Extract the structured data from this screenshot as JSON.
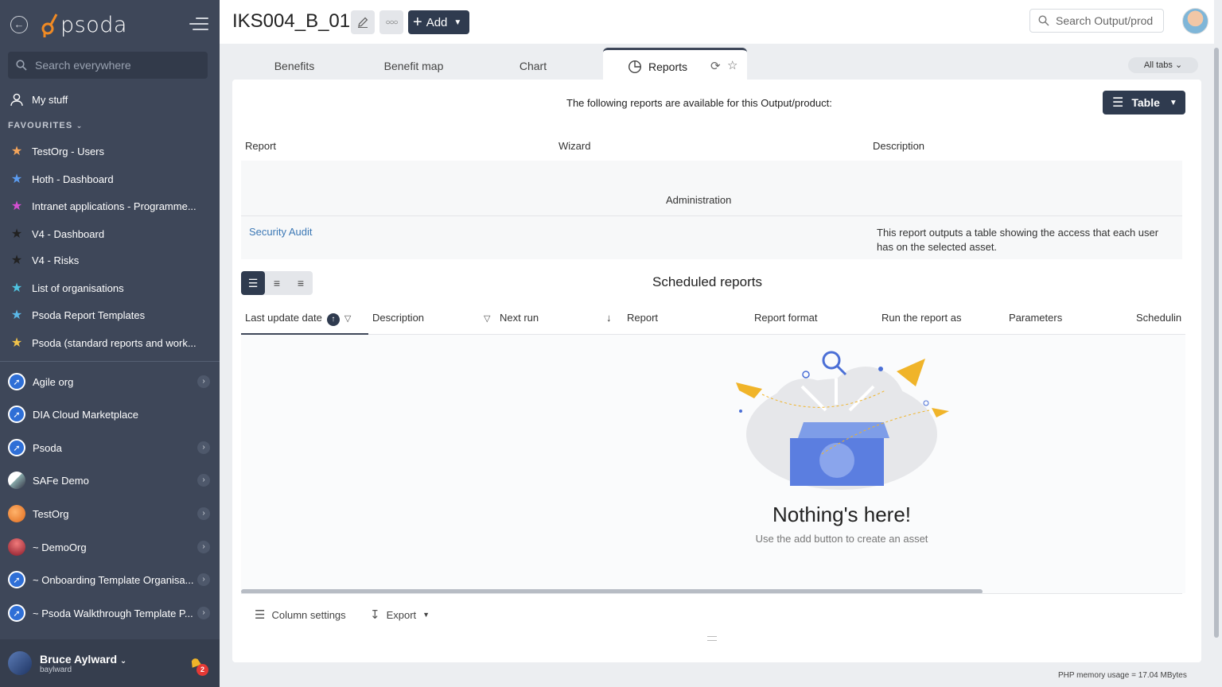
{
  "sidebar": {
    "logo_text": "psoda",
    "search_placeholder": "Search everywhere",
    "my_stuff": "My stuff",
    "favourites_header": "FAVOURITES",
    "favourites": [
      {
        "label": "TestOrg - Users",
        "star_color": "#f5a55a"
      },
      {
        "label": "Hoth - Dashboard",
        "star_color": "#5b9cf0"
      },
      {
        "label": "Intranet applications - Programme...",
        "star_color": "#d44fd1"
      },
      {
        "label": "V4 - Dashboard",
        "star_color": "#222222"
      },
      {
        "label": "V4 - Risks",
        "star_color": "#222222"
      },
      {
        "label": "List of organisations",
        "star_color": "#4ec3e0"
      },
      {
        "label": "Psoda Report Templates",
        "star_color": "#5bb8e8"
      },
      {
        "label": "Psoda (standard reports and work...",
        "star_color": "#f0c24a"
      }
    ],
    "orgs": [
      {
        "label": "Agile org",
        "chevron": true
      },
      {
        "label": "DIA Cloud Marketplace",
        "chevron": false
      },
      {
        "label": "Psoda",
        "chevron": true
      },
      {
        "label": "SAFe Demo",
        "chevron": true
      },
      {
        "label": "TestOrg",
        "chevron": true
      },
      {
        "label": "~ DemoOrg",
        "chevron": true
      },
      {
        "label": "~ Onboarding Template Organisa...",
        "chevron": true
      },
      {
        "label": "~ Psoda Walkthrough Template P...",
        "chevron": true
      }
    ],
    "user": {
      "name": "Bruce Aylward",
      "login": "baylward",
      "notifications": "2"
    }
  },
  "topbar": {
    "title": "IKS004_B_01",
    "add_label": "Add",
    "search_placeholder": "Search Output/prod"
  },
  "tabs": {
    "items": [
      "Benefits",
      "Benefit map",
      "Chart"
    ],
    "active": "Reports",
    "all_tabs": "All tabs"
  },
  "reports": {
    "intro": "The following reports are available for this Output/product:",
    "view_button": "Table",
    "columns": [
      "Report",
      "Wizard",
      "Description"
    ],
    "group": "Administration",
    "rows": [
      {
        "report": "Security Audit",
        "wizard": "",
        "description": "This report outputs a table showing the access that each user has on the selected asset."
      }
    ]
  },
  "scheduled": {
    "title": "Scheduled reports",
    "columns": [
      "Last update date",
      "Description",
      "Next run",
      "Report",
      "Report format",
      "Run the report as",
      "Parameters",
      "Schedulin"
    ],
    "empty_title": "Nothing's here!",
    "empty_sub": "Use the add button to create an asset",
    "column_settings": "Column settings",
    "export": "Export"
  },
  "footer": {
    "memory": "PHP memory usage = 17.04 MBytes"
  },
  "colors": {
    "sidebar_bg": "#3e4759",
    "primary_dark": "#2f3b4f",
    "link": "#3c78b5"
  }
}
